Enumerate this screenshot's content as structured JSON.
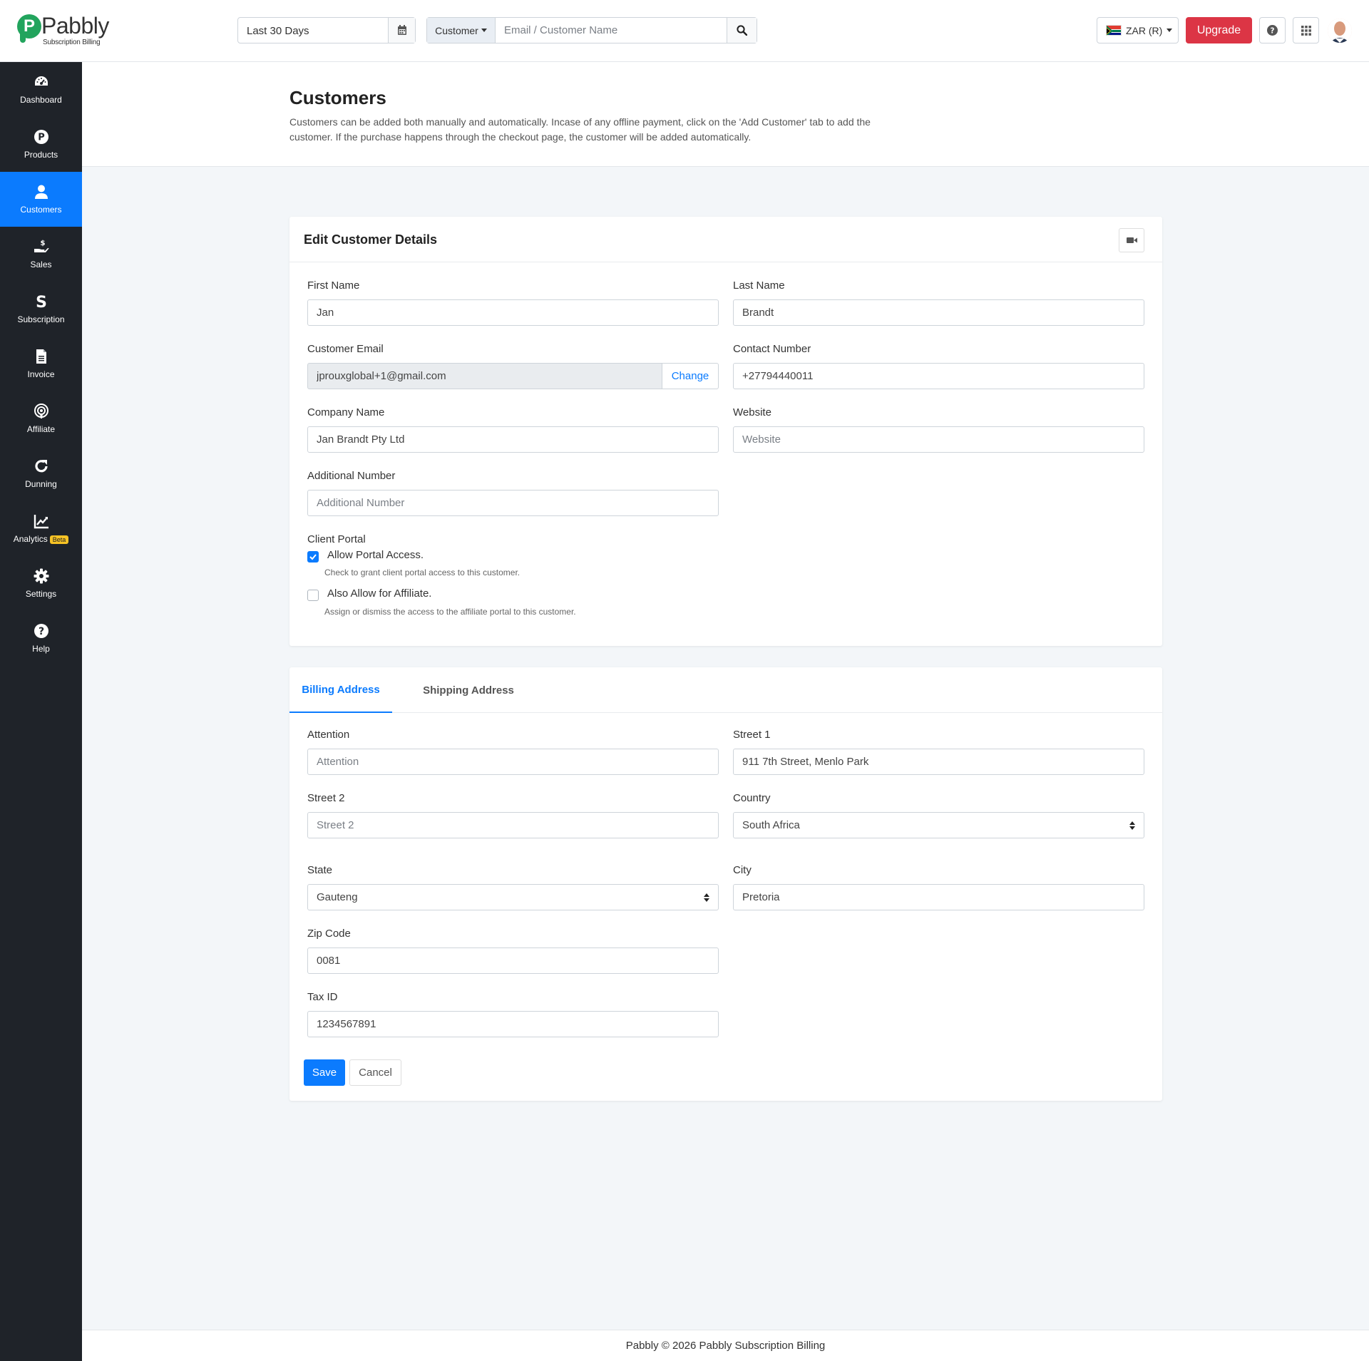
{
  "brand": {
    "name": "Pabbly",
    "subtitle": "Subscription Billing",
    "green": "#22a45d"
  },
  "header": {
    "date_range": "Last 30 Days",
    "search_type": "Customer",
    "search_placeholder": "Email / Customer Name",
    "currency": "ZAR (R)",
    "upgrade_label": "Upgrade"
  },
  "sidebar": {
    "items": [
      {
        "label": "Dashboard",
        "icon": "speedometer-icon"
      },
      {
        "label": "Products",
        "icon": "product-p-icon"
      },
      {
        "label": "Customers",
        "icon": "user-icon",
        "active": true
      },
      {
        "label": "Sales",
        "icon": "sales-hand-icon"
      },
      {
        "label": "Subscription",
        "icon": "dollar-s-icon"
      },
      {
        "label": "Invoice",
        "icon": "document-icon"
      },
      {
        "label": "Affiliate",
        "icon": "broadcast-icon"
      },
      {
        "label": "Dunning",
        "icon": "refresh-icon"
      },
      {
        "label": "Analytics",
        "icon": "chart-line-icon",
        "badge": "Beta"
      },
      {
        "label": "Settings",
        "icon": "gear-icon"
      },
      {
        "label": "Help",
        "icon": "question-icon"
      }
    ]
  },
  "page": {
    "title": "Customers",
    "description": "Customers can be added both manually and automatically. Incase of any offline payment, click on the 'Add Customer' tab to add the customer. If the purchase happens through the checkout page, the customer will be added automatically."
  },
  "edit_card": {
    "title": "Edit Customer Details",
    "first_name": {
      "label": "First Name",
      "value": "Jan"
    },
    "last_name": {
      "label": "Last Name",
      "value": "Brandt"
    },
    "email": {
      "label": "Customer Email",
      "value": "jprouxglobal+1@gmail.com",
      "change_label": "Change"
    },
    "contact": {
      "label": "Contact Number",
      "value": "+27794440011"
    },
    "company": {
      "label": "Company Name",
      "value": "Jan Brandt Pty Ltd"
    },
    "website": {
      "label": "Website",
      "placeholder": "Website"
    },
    "additional": {
      "label": "Additional Number",
      "placeholder": "Additional Number"
    },
    "client_portal": {
      "label": "Client Portal",
      "allow_portal": {
        "label": "Allow Portal Access.",
        "help": "Check to grant client portal access to this customer.",
        "checked": true
      },
      "allow_affiliate": {
        "label": "Also Allow for Affiliate.",
        "help": "Assign or dismiss the access to the affiliate portal to this customer.",
        "checked": false
      }
    }
  },
  "address_card": {
    "tabs": [
      {
        "label": "Billing Address",
        "active": true
      },
      {
        "label": "Shipping Address",
        "active": false
      }
    ],
    "attention": {
      "label": "Attention",
      "placeholder": "Attention"
    },
    "street1": {
      "label": "Street 1",
      "value": "911 7th Street, Menlo Park"
    },
    "street2": {
      "label": "Street 2",
      "placeholder": "Street 2"
    },
    "country": {
      "label": "Country",
      "value": "South Africa"
    },
    "state": {
      "label": "State",
      "value": "Gauteng"
    },
    "city": {
      "label": "City",
      "value": "Pretoria"
    },
    "zip": {
      "label": "Zip Code",
      "value": "0081"
    },
    "tax": {
      "label": "Tax ID",
      "value": "1234567891"
    },
    "save_label": "Save",
    "cancel_label": "Cancel"
  },
  "footer": {
    "text": "Pabbly © 2026 Pabbly Subscription Billing"
  },
  "colors": {
    "primary": "#0b7bfe",
    "danger": "#dc3545",
    "sidebar": "#1f2329",
    "beta": "#f7c325"
  }
}
